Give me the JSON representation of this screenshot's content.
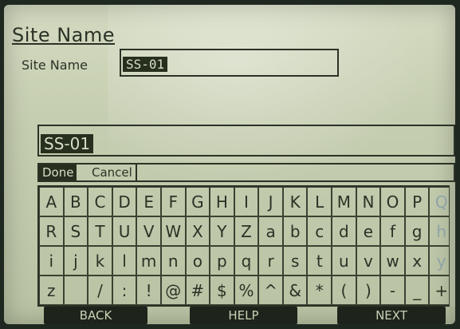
{
  "header": {
    "title": "Site Name"
  },
  "site_name": {
    "label": "Site Name",
    "value": "SS-01"
  },
  "keyboard": {
    "entry_value": "SS-01",
    "done_label": "Done",
    "cancel_label": "Cancel",
    "rows": [
      [
        "A",
        "B",
        "C",
        "D",
        "E",
        "F",
        "G",
        "H",
        "I",
        "J",
        "K",
        "L",
        "M",
        "N",
        "O",
        "P",
        "Q"
      ],
      [
        "R",
        "S",
        "T",
        "U",
        "V",
        "W",
        "X",
        "Y",
        "Z",
        "a",
        "b",
        "c",
        "d",
        "e",
        "f",
        "g",
        "h"
      ],
      [
        "i",
        "j",
        "k",
        "l",
        "m",
        "n",
        "o",
        "p",
        "q",
        "r",
        "s",
        "t",
        "u",
        "v",
        "w",
        "x",
        "y"
      ],
      [
        "z",
        " ",
        "/",
        ":",
        "!",
        "@",
        "#",
        "$",
        "%",
        "^",
        "&",
        "*",
        "(",
        ")",
        "-",
        "_",
        "+"
      ]
    ],
    "faded_keys": [
      "Q",
      "h",
      "y"
    ]
  },
  "softkeys": {
    "back": "BACK",
    "help": "HELP",
    "next": "NEXT"
  }
}
